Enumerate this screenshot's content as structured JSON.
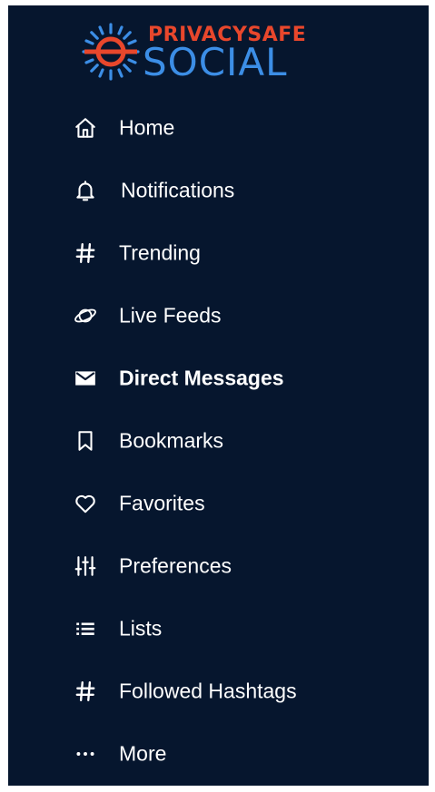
{
  "brand": {
    "line1": "PRIVACYSAFE",
    "line2": "SOCIAL",
    "colors": {
      "sun_red": "#e8472c",
      "sun_blue": "#3c8ee6",
      "background": "#06162e",
      "text": "#ffffff"
    }
  },
  "nav": {
    "items": [
      {
        "id": "home",
        "label": "Home",
        "icon": "home-icon"
      },
      {
        "id": "notifications",
        "label": "Notifications",
        "icon": "bell-icon"
      },
      {
        "id": "trending",
        "label": "Trending",
        "icon": "hashtag-icon"
      },
      {
        "id": "live-feeds",
        "label": "Live Feeds",
        "icon": "planet-icon"
      },
      {
        "id": "direct-messages",
        "label": "Direct Messages",
        "icon": "envelope-icon",
        "active": true
      },
      {
        "id": "bookmarks",
        "label": "Bookmarks",
        "icon": "bookmark-icon"
      },
      {
        "id": "favorites",
        "label": "Favorites",
        "icon": "heart-icon"
      },
      {
        "id": "preferences",
        "label": "Preferences",
        "icon": "sliders-icon"
      },
      {
        "id": "lists",
        "label": "Lists",
        "icon": "list-icon"
      },
      {
        "id": "followed-hashtags",
        "label": "Followed Hashtags",
        "icon": "hashtag-icon"
      },
      {
        "id": "more",
        "label": "More",
        "icon": "ellipsis-icon"
      }
    ]
  }
}
